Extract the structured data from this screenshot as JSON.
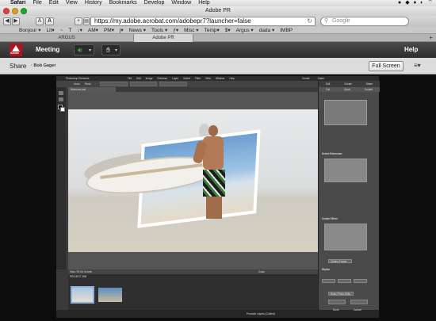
{
  "menubar": {
    "app_name": "Safari",
    "items": [
      "File",
      "Edit",
      "View",
      "History",
      "Bookmarks",
      "Develop",
      "Window",
      "Help"
    ]
  },
  "window": {
    "title": "Adobe PR"
  },
  "toolbar": {
    "url": "https://my.adobe.acrobat.com/adobepr7?launcher=false",
    "search_placeholder": "Google",
    "font_small": "A",
    "font_large": "A"
  },
  "bookmarks": [
    "Bonjour ▾",
    "Lit▾",
    "~",
    "T",
    "↓▾",
    "AM▾",
    "PM▾",
    "j▾",
    "News ▾",
    "Tools ▾",
    "ƒ▾",
    "Misc ▾",
    "Temp▾",
    "$▾",
    "Argus ▾",
    "dada ▾",
    "IMBP"
  ],
  "tabs": [
    "ARGUS",
    "Adobe PR"
  ],
  "meeting": {
    "logo": "Adobe",
    "menu_label": "Meeting",
    "help_label": "Help"
  },
  "share": {
    "title": "Share",
    "presenter": "· Bob Gager",
    "full_screen_label": "Full Screen"
  },
  "pse": {
    "app_title": "Photoshop Elements",
    "menus": [
      "File",
      "Edit",
      "Image",
      "Enhance",
      "Layer",
      "Select",
      "Filter",
      "View",
      "Window",
      "Help"
    ],
    "file_tab": "Welcome.psd",
    "top_right": [
      "Create",
      "Share"
    ],
    "doc_buttons": [
      "Undo",
      "Redo"
    ],
    "panel_tabs": [
      "Edit",
      "Create",
      "Share"
    ],
    "panel_subtabs": [
      "Full",
      "Quick",
      "Guided"
    ],
    "panel_headings": [
      "Select Extension",
      "Create Effect",
      "Stylize"
    ],
    "panel_buttons": [
      "Outline Frame",
      "Basic Photo Edits",
      "Done",
      "Cancel"
    ],
    "status": {
      "view": "View: Fit On Screen",
      "zoom": "Zoom"
    },
    "project_bin_label": "PROJECT BIN",
    "bottom_label": "Promote Layers (Guided)"
  },
  "colors": {
    "adobe_red": "#b1121b",
    "speaker_green": "#35b53a",
    "meeting_bar": "#3a3a3a",
    "pse_panel": "#4a4a4a"
  },
  "icons": [
    "apple-icon",
    "back-icon",
    "forward-icon",
    "add-tab-icon",
    "reader-icon",
    "reload-icon",
    "search-icon",
    "speaker-icon",
    "person-icon",
    "share-options-icon"
  ]
}
